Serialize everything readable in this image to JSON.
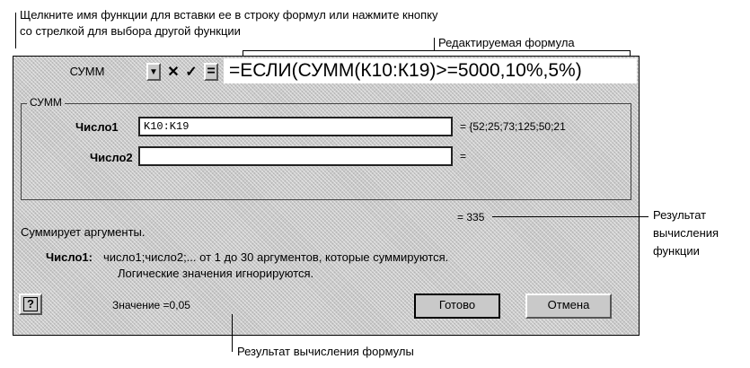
{
  "annotations": {
    "top_line1": "Щелкните имя функции для вставки ее в строку формул или нажмите кнопку",
    "top_line2": "со стрелкой для выбора другой функции",
    "edited_formula": "Редактируемая формула",
    "function_result": [
      "Результат",
      "вычисления",
      "функции"
    ],
    "formula_result": "Результат вычисления формулы"
  },
  "formula_bar": {
    "name_box": "СУММ",
    "cancel_icon": "✕",
    "enter_icon": "✓",
    "equals_icon": "=",
    "formula": "=ЕСЛИ(СУММ(К10:К19)>=5000,10%,5%)"
  },
  "dialog": {
    "group_label": "СУММ",
    "arg1_label": "Число1",
    "arg1_value": "K10:K19",
    "arg1_result": "= {52;25;73;125;50;21",
    "arg2_label": "Число2",
    "arg2_value": "",
    "arg2_result": "=",
    "total_result": "= 335",
    "description": "Суммирует аргументы.",
    "help_label": "Число1:",
    "help_text": "число1;число2;... от 1 до 30 аргументов, которые суммируются.",
    "help_text2": "Логические значения игнорируются.",
    "help_icon": "?",
    "value_text": "Значение =0,05",
    "ok_label": "Готово",
    "cancel_label": "Отмена"
  }
}
